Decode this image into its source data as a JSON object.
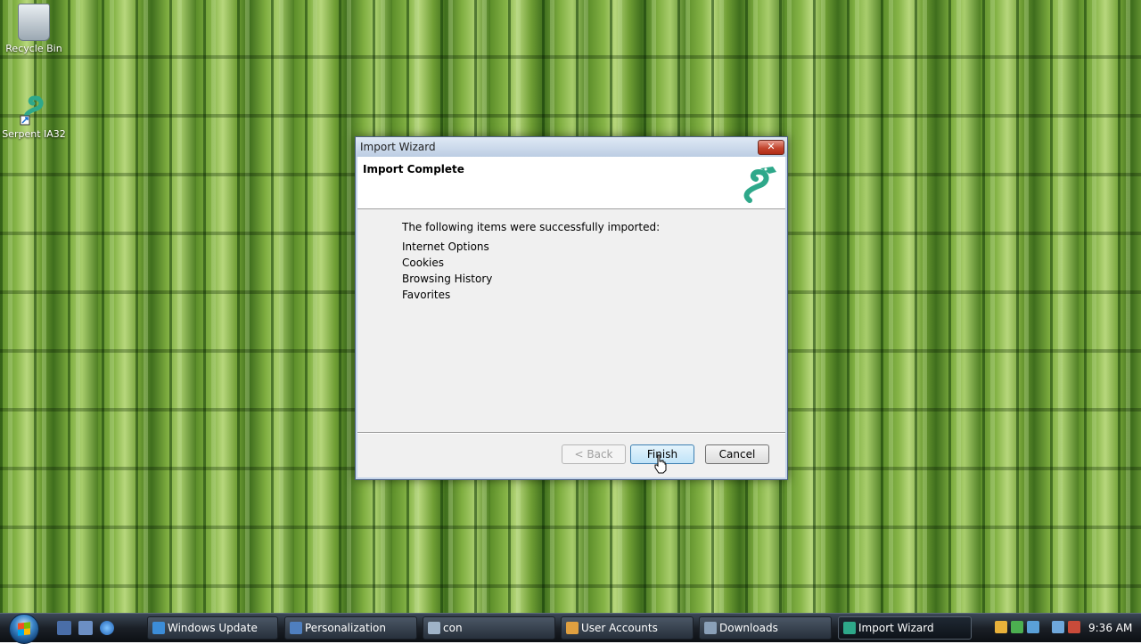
{
  "desktop": {
    "icons": [
      {
        "label": "Recycle Bin"
      },
      {
        "label": "Serpent IA32"
      }
    ]
  },
  "dialog": {
    "title": "Import Wizard",
    "close_glyph": "✕",
    "header_title": "Import Complete",
    "intro": "The following items were successfully imported:",
    "items": [
      "Internet Options",
      "Cookies",
      "Browsing History",
      "Favorites"
    ],
    "buttons": {
      "back": "< Back",
      "finish": "Finish",
      "cancel": "Cancel"
    }
  },
  "taskbar": {
    "tasks": [
      {
        "label": "Windows Update",
        "icon": "shield-update-icon"
      },
      {
        "label": "Personalization",
        "icon": "monitor-icon"
      },
      {
        "label": "con",
        "icon": "document-icon"
      },
      {
        "label": "User Accounts",
        "icon": "users-icon"
      },
      {
        "label": "Downloads",
        "icon": "folder-icon"
      },
      {
        "label": "Import Wizard",
        "icon": "serpent-icon"
      }
    ],
    "clock": "9:36 AM"
  },
  "colors": {
    "dialog_frame": "#c6d6ea",
    "primary_button": "#bfe3f8",
    "close_button": "#c3462f"
  }
}
